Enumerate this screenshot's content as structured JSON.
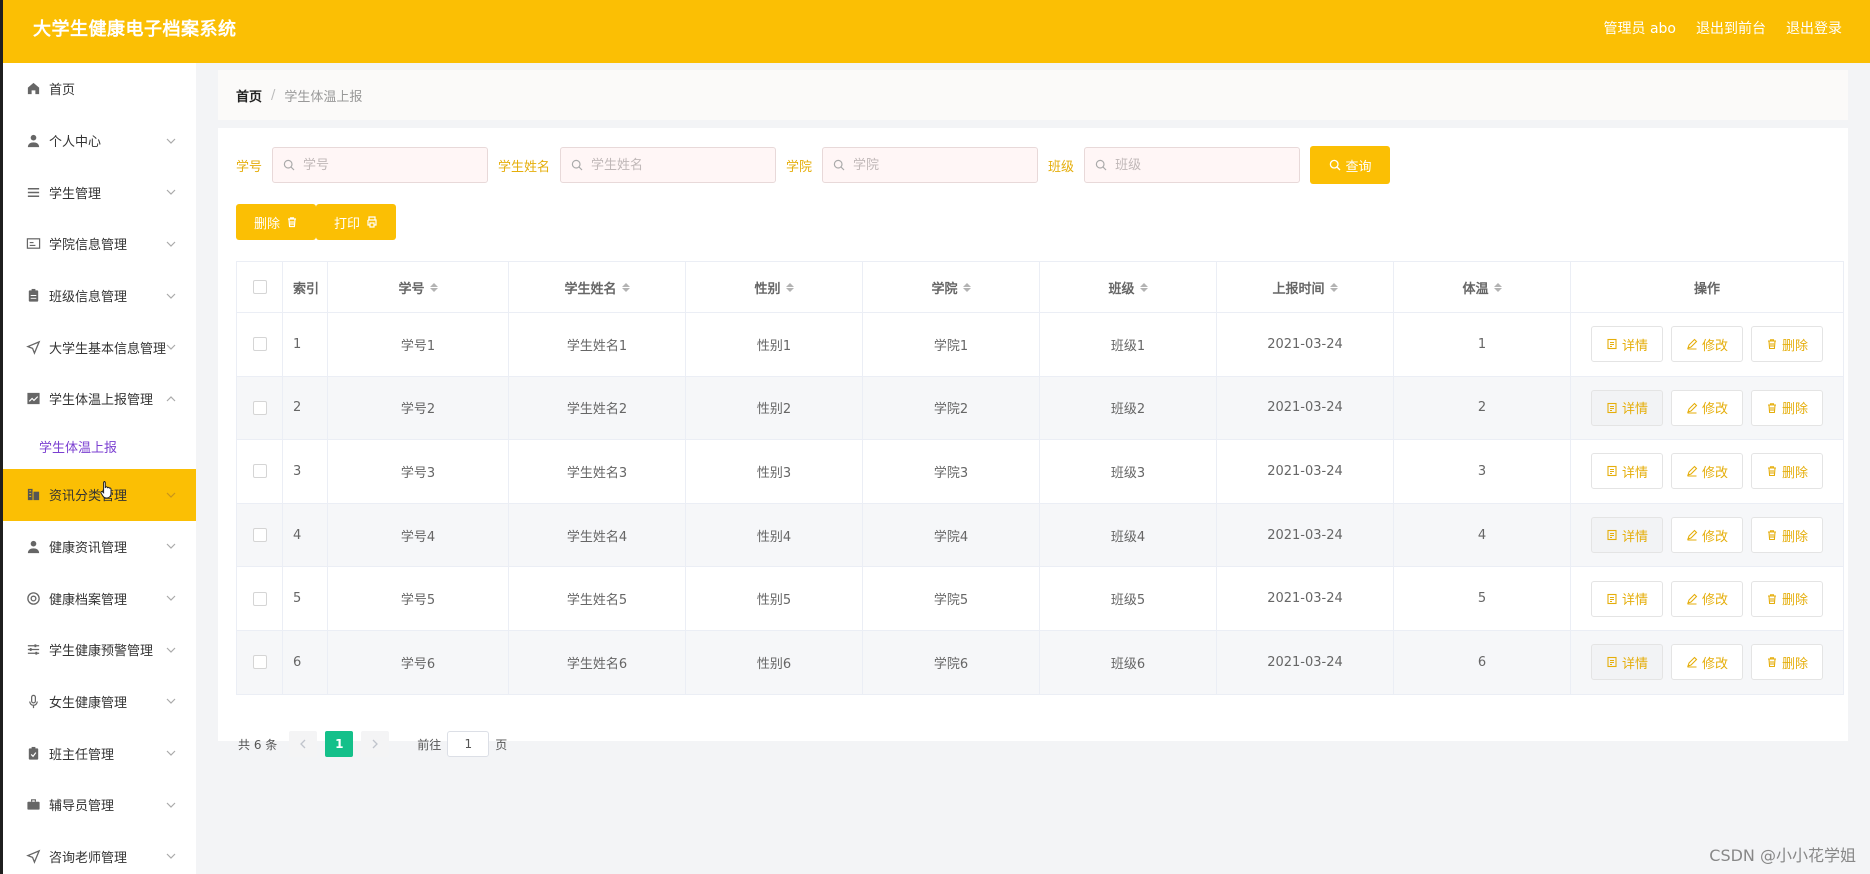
{
  "header": {
    "title": "大学生健康电子档案系统",
    "links": [
      "管理员 abo",
      "退出到前台",
      "退出登录"
    ]
  },
  "sidebar": {
    "items": [
      {
        "label": "首页",
        "icon": "home-icon",
        "arrow": false
      },
      {
        "label": "个人中心",
        "icon": "user-icon",
        "arrow": true
      },
      {
        "label": "学生管理",
        "icon": "list-icon",
        "arrow": true
      },
      {
        "label": "学院信息管理",
        "icon": "card-icon",
        "arrow": true
      },
      {
        "label": "班级信息管理",
        "icon": "clipboard-icon",
        "arrow": true
      },
      {
        "label": "大学生基本信息管理",
        "icon": "send-icon",
        "arrow": true
      },
      {
        "label": "学生体温上报管理",
        "icon": "chart-icon",
        "arrow": true,
        "expanded": true
      },
      {
        "label": "资讯分类管理",
        "icon": "building-icon",
        "arrow": true,
        "active": true
      },
      {
        "label": "健康资讯管理",
        "icon": "user-icon",
        "arrow": true
      },
      {
        "label": "健康档案管理",
        "icon": "life-ring-icon",
        "arrow": true
      },
      {
        "label": "学生健康预警管理",
        "icon": "sliders-icon",
        "arrow": true
      },
      {
        "label": "女生健康管理",
        "icon": "microphone-icon",
        "arrow": true
      },
      {
        "label": "班主任管理",
        "icon": "clipboard-check-icon",
        "arrow": true
      },
      {
        "label": "辅导员管理",
        "icon": "briefcase-icon",
        "arrow": true
      },
      {
        "label": "咨询老师管理",
        "icon": "send-icon",
        "arrow": true
      }
    ],
    "sub_item": "学生体温上报"
  },
  "breadcrumb": {
    "home": "首页",
    "sep": "/",
    "current": "学生体温上报"
  },
  "search": {
    "fields": [
      {
        "label": "学号",
        "placeholder": "学号"
      },
      {
        "label": "学生姓名",
        "placeholder": "学生姓名"
      },
      {
        "label": "学院",
        "placeholder": "学院"
      },
      {
        "label": "班级",
        "placeholder": "班级"
      }
    ],
    "query_label": "查询"
  },
  "actions": {
    "delete_label": "删除",
    "print_label": "打印"
  },
  "table": {
    "headers": [
      "索引",
      "学号",
      "学生姓名",
      "性别",
      "学院",
      "班级",
      "上报时间",
      "体温",
      "操作"
    ],
    "rows": [
      [
        "1",
        "学号1",
        "学生姓名1",
        "性别1",
        "学院1",
        "班级1",
        "2021-03-24",
        "1"
      ],
      [
        "2",
        "学号2",
        "学生姓名2",
        "性别2",
        "学院2",
        "班级2",
        "2021-03-24",
        "2"
      ],
      [
        "3",
        "学号3",
        "学生姓名3",
        "性别3",
        "学院3",
        "班级3",
        "2021-03-24",
        "3"
      ],
      [
        "4",
        "学号4",
        "学生姓名4",
        "性别4",
        "学院4",
        "班级4",
        "2021-03-24",
        "4"
      ],
      [
        "5",
        "学号5",
        "学生姓名5",
        "性别5",
        "学院5",
        "班级5",
        "2021-03-24",
        "5"
      ],
      [
        "6",
        "学号6",
        "学生姓名6",
        "性别6",
        "学院6",
        "班级6",
        "2021-03-24",
        "6"
      ]
    ],
    "op_labels": {
      "detail": "详情",
      "edit": "修改",
      "delete": "删除"
    }
  },
  "pagination": {
    "total": "共 6 条",
    "current_page": "1",
    "goto_prefix": "前往",
    "goto_value": "1",
    "goto_suffix": "页"
  },
  "watermark": "CSDN @小小花学姐",
  "colors": {
    "accent": "#fbbf04",
    "active_page": "#14c08a",
    "sub_item": "#7b3fd1",
    "label": "#e5ae0b"
  }
}
